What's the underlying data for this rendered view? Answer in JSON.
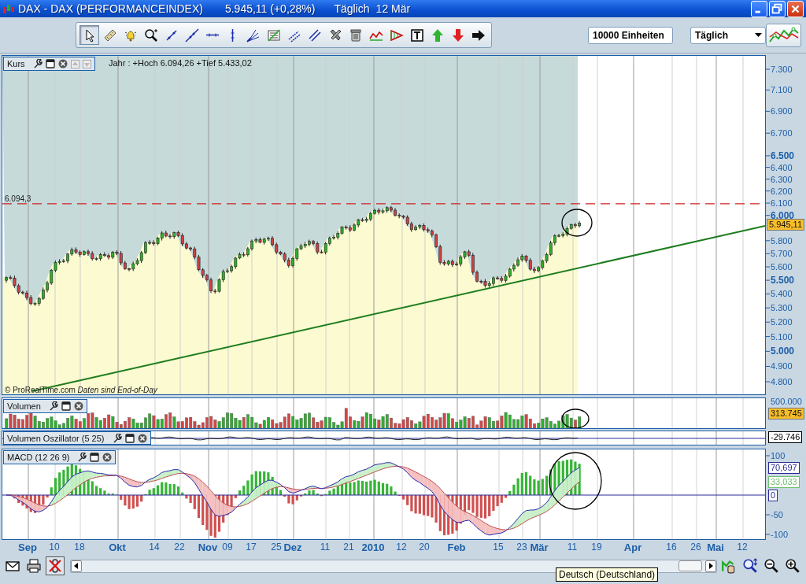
{
  "window": {
    "title": "DAX - DAX (PERFORMANCEINDEX)",
    "quote": "5.945,11 (+0,28%)",
    "period": "Täglich",
    "date": "12 Mär"
  },
  "toolbar": {
    "tools": [
      {
        "kind": "pointer",
        "selected": true
      },
      {
        "kind": "ruler",
        "selected": false
      },
      {
        "kind": "alarm",
        "selected": false
      },
      {
        "kind": "zoom",
        "selected": false
      },
      {
        "kind": "line",
        "selected": false
      },
      {
        "kind": "ray",
        "selected": false
      },
      {
        "kind": "hline",
        "selected": false
      },
      {
        "kind": "vline",
        "selected": false
      },
      {
        "kind": "fan",
        "selected": false
      },
      {
        "kind": "fib",
        "selected": false
      },
      {
        "kind": "channel",
        "selected": false
      },
      {
        "kind": "parallel",
        "selected": false
      },
      {
        "kind": "tools",
        "selected": false
      },
      {
        "kind": "trash",
        "selected": false
      },
      {
        "kind": "wave",
        "selected": false
      },
      {
        "kind": "triangle",
        "selected": false
      },
      {
        "kind": "text",
        "selected": false
      },
      {
        "kind": "up",
        "selected": false
      },
      {
        "kind": "down",
        "selected": false
      },
      {
        "kind": "right",
        "selected": false
      }
    ],
    "quantity": "10000 Einheiten",
    "interval": "Täglich"
  },
  "price_panel": {
    "title": "Kurs",
    "info": "Jahr : +Hoch 6.094,26 +Tief 5.433,02",
    "line_label": "6.094,3",
    "credit": "© ProRealTime.com",
    "credit_note": "Daten sind End-of-Day",
    "price_badge": "5.945,11",
    "yticks": [
      {
        "label": "7.300",
        "major": false
      },
      {
        "label": "7.100",
        "major": false
      },
      {
        "label": "6.900",
        "major": false
      },
      {
        "label": "6.700",
        "major": false
      },
      {
        "label": "6.500",
        "major": true
      },
      {
        "label": "6.400",
        "major": false
      },
      {
        "label": "6.300",
        "major": false
      },
      {
        "label": "6.200",
        "major": false
      },
      {
        "label": "6.100",
        "major": false
      },
      {
        "label": "6.000",
        "major": true
      },
      {
        "label": "5.800",
        "major": false
      },
      {
        "label": "5.700",
        "major": false
      },
      {
        "label": "5.600",
        "major": false
      },
      {
        "label": "5.500",
        "major": true
      },
      {
        "label": "5.400",
        "major": false
      },
      {
        "label": "5.300",
        "major": false
      },
      {
        "label": "5.200",
        "major": false
      },
      {
        "label": "5.100",
        "major": false
      },
      {
        "label": "5.000",
        "major": true
      },
      {
        "label": "4.900",
        "major": false
      },
      {
        "label": "4.800",
        "major": false
      }
    ]
  },
  "volume_panel": {
    "title": "Volumen",
    "ytick": "500.000",
    "badge": "313.745"
  },
  "oscillator_panel": {
    "title": "Volumen Oszillator (5 25)",
    "badge": "-29.746"
  },
  "macd_panel": {
    "title": "MACD (12 26 9)",
    "yticks": [
      "100",
      "-50",
      "-100"
    ],
    "badges": [
      {
        "label": "70,697",
        "color": "#2a2a9a"
      },
      {
        "label": "33,033",
        "color": "#6fc06f"
      },
      {
        "label": "0",
        "color": "#2a2a9a"
      }
    ]
  },
  "date_axis": [
    {
      "label": "Sep",
      "major": true
    },
    {
      "label": "10",
      "major": false
    },
    {
      "label": "18",
      "major": false
    },
    {
      "label": "Okt",
      "major": true
    },
    {
      "label": "14",
      "major": false
    },
    {
      "label": "22",
      "major": false
    },
    {
      "label": "Nov",
      "major": true
    },
    {
      "label": "09",
      "major": false
    },
    {
      "label": "17",
      "major": false
    },
    {
      "label": "25",
      "major": false
    },
    {
      "label": "Dez",
      "major": true
    },
    {
      "label": "11",
      "major": false
    },
    {
      "label": "21",
      "major": false
    },
    {
      "label": "2010",
      "major": true
    },
    {
      "label": "12",
      "major": false
    },
    {
      "label": "20",
      "major": false
    },
    {
      "label": "Feb",
      "major": true
    },
    {
      "label": "15",
      "major": false
    },
    {
      "label": "23",
      "major": false
    },
    {
      "label": "Mär",
      "major": true
    },
    {
      "label": "11",
      "major": false
    },
    {
      "label": "19",
      "major": false
    },
    {
      "label": "Apr",
      "major": true
    },
    {
      "label": "16",
      "major": false
    },
    {
      "label": "26",
      "major": false
    },
    {
      "label": "Mai",
      "major": true
    },
    {
      "label": "12",
      "major": false
    }
  ],
  "status_bar": {
    "buttons": [
      {
        "kind": "mail",
        "pressed": false
      },
      {
        "kind": "print",
        "pressed": false
      },
      {
        "kind": "unlink",
        "pressed": true
      }
    ],
    "tools": [
      {
        "kind": "hand-chart"
      },
      {
        "kind": "zoom-fit"
      },
      {
        "kind": "zoom-out"
      },
      {
        "kind": "zoom-in"
      }
    ],
    "tooltip": "Deutsch (Deutschland)"
  }
}
